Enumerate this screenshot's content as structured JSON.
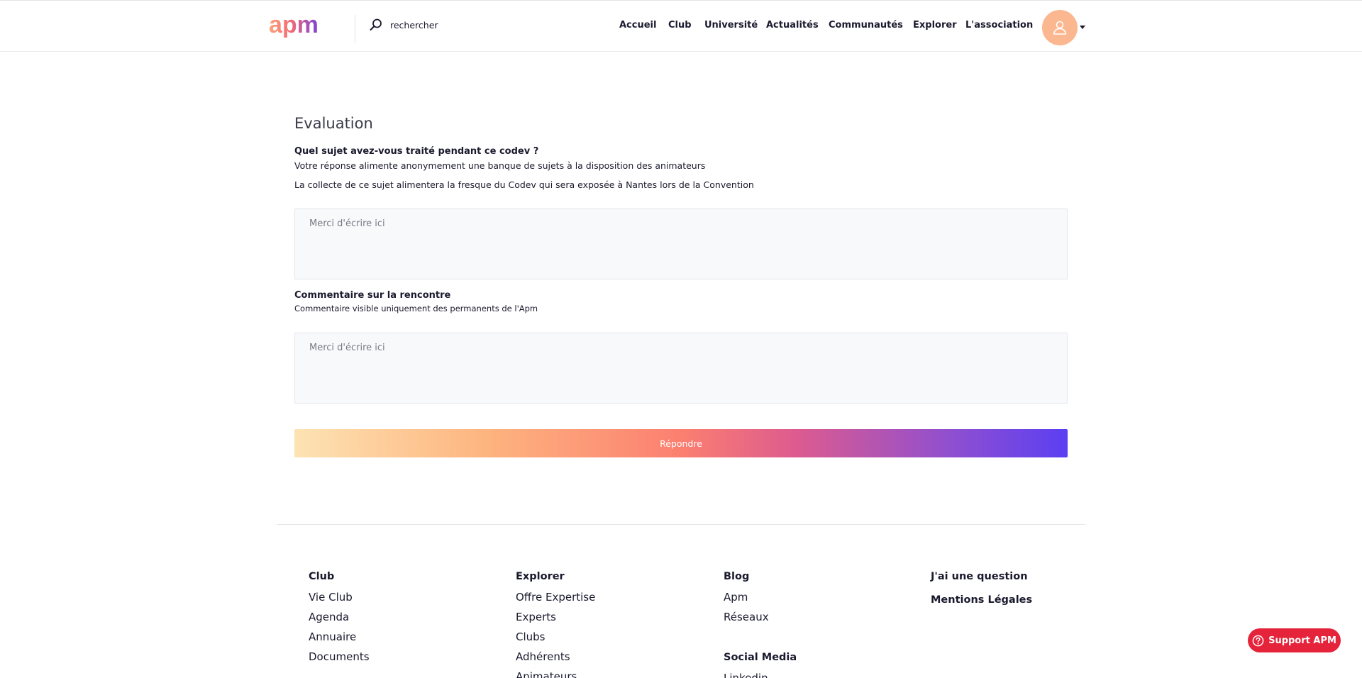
{
  "header": {
    "logo_text": "apm",
    "search_placeholder": "rechercher",
    "nav": [
      "Accueil",
      "Club",
      "Université",
      "Actualités",
      "Communautés",
      "Explorer",
      "L'association"
    ]
  },
  "form": {
    "title": "Evaluation",
    "question_label": "Quel sujet avez-vous traité pendant ce codev ?",
    "question_help_1": "Votre réponse alimente anonymement une banque de sujets à la disposition des animateurs",
    "question_help_2": "La collecte de ce sujet alimentera la fresque du Codev qui sera exposée à Nantes lors de la Convention",
    "question_placeholder": "Merci d'écrire ici",
    "comment_label": "Commentaire sur la rencontre",
    "comment_help": "Commentaire visible uniquement des permanents de l'Apm",
    "comment_placeholder": "Merci d'écrire ici",
    "submit_label": "Répondre"
  },
  "footer": {
    "col1": {
      "heading": "Club",
      "links": [
        "Vie Club",
        "Agenda",
        "Annuaire",
        "Documents"
      ]
    },
    "col2": {
      "heading": "Explorer",
      "links": [
        "Offre Expertise",
        "Experts",
        "Clubs",
        "Adhérents",
        "Animateurs"
      ]
    },
    "col3": {
      "heading": "Blog",
      "links": [
        "Apm",
        "Réseaux"
      ],
      "heading2": "Social Media",
      "links2": [
        "Linkedin"
      ]
    },
    "col4": {
      "heading": "J'ai une question",
      "heading2": "Mentions Légales"
    }
  },
  "support": {
    "label": "Support APM"
  },
  "colors": {
    "accent": "#e5233a",
    "avatar": "#fbb78f",
    "gradient_start": "#fde3b3",
    "gradient_end": "#5b3ff2"
  }
}
